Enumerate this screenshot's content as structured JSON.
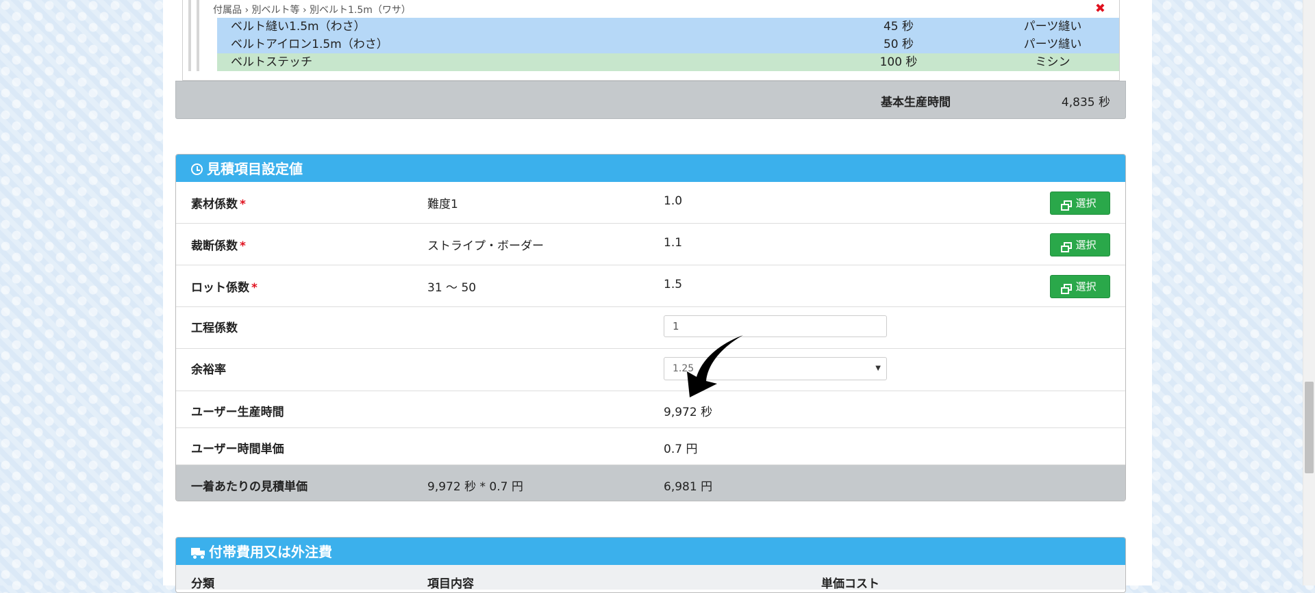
{
  "process_list": {
    "breadcrumb": "付属品 › 別ベルト等 › 別ベルト1.5m（ワサ）",
    "close_icon": "close-icon",
    "rows": [
      {
        "name": "ベルト縫い1.5m（わさ）",
        "seconds": "45 秒",
        "category": "パーツ縫い",
        "color": "#b6d8f7"
      },
      {
        "name": "ベルトアイロン1.5m（わさ）",
        "seconds": "50 秒",
        "category": "パーツ縫い",
        "color": "#b6d8f7"
      },
      {
        "name": "ベルトステッチ",
        "seconds": "100 秒",
        "category": "ミシン",
        "color": "#c7e6cc"
      }
    ],
    "base_time_label": "基本生産時間",
    "base_time_value": "4,835 秒"
  },
  "estimate_panel": {
    "title": "見積項目設定値",
    "icon": "clock-icon",
    "required_mark": "*",
    "select_label": "選択",
    "rows": {
      "material": {
        "label": "素材係数",
        "name": "難度1",
        "value": "1.0"
      },
      "cutting": {
        "label": "裁断係数",
        "name": "ストライプ・ボーダー",
        "value": "1.1"
      },
      "lot": {
        "label": "ロット係数",
        "name": "31 ～ 50",
        "value": "1.5"
      },
      "process": {
        "label": "工程係数",
        "input_value": "1"
      },
      "margin": {
        "label": "余裕率",
        "selected": "1.25"
      },
      "user_time": {
        "label": "ユーザー生産時間",
        "value": "9,972 秒"
      },
      "user_rate": {
        "label": "ユーザー時間単価",
        "value": "0.7 円"
      },
      "unit_price": {
        "label": "一着あたりの見積単価",
        "formula": "9,972 秒 * 0.7 円",
        "value": "6,981 円"
      }
    }
  },
  "cost_panel": {
    "title": "付帯費用又は外注費",
    "icon": "truck-icon",
    "columns": [
      "分類",
      "項目内容",
      "単価コスト"
    ]
  },
  "colors": {
    "header_blue": "#3bb0ec",
    "select_green": "#2aa84a",
    "summary_gray": "#c5c9cc",
    "required_red": "#e0111e"
  }
}
